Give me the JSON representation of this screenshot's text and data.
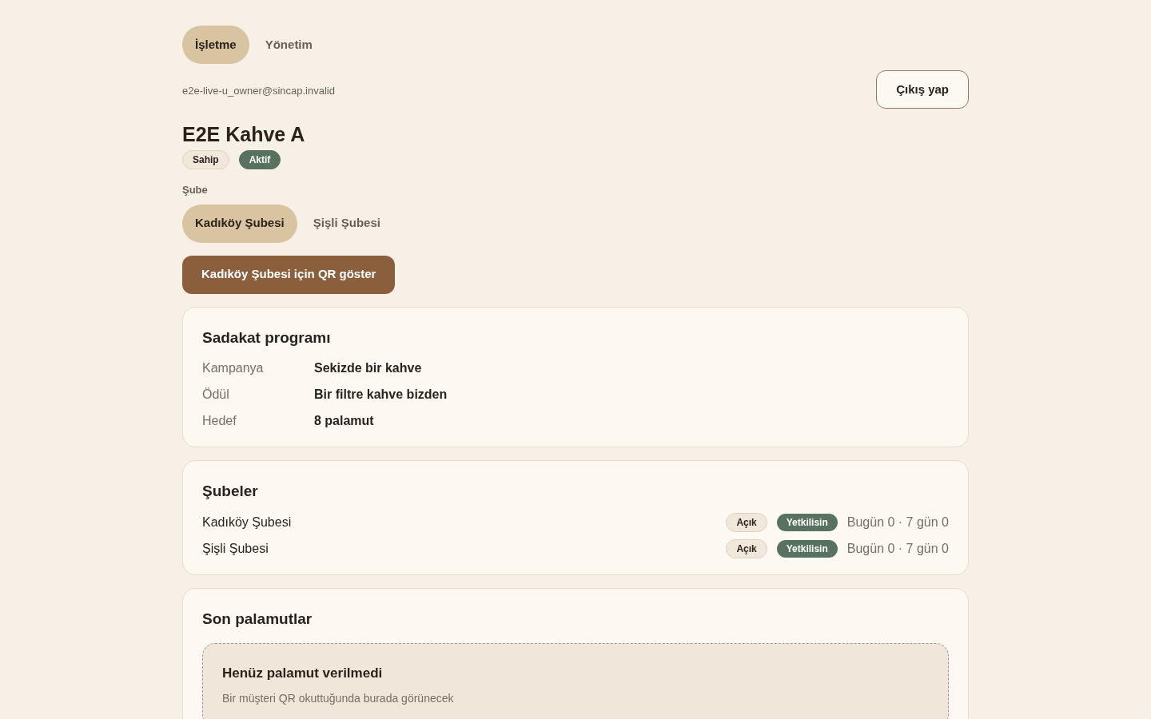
{
  "top_tabs": [
    {
      "label": "İşletme",
      "selected": true
    },
    {
      "label": "Yönetim",
      "selected": false
    }
  ],
  "account": {
    "email": "e2e-live-u_owner@sincap.invalid",
    "logout": "Çıkış yap"
  },
  "business": {
    "name": "E2E Kahve A",
    "badges": [
      {
        "label": "Sahip",
        "kind": "neutral"
      },
      {
        "label": "Aktif",
        "kind": "success"
      }
    ]
  },
  "branch_picker": {
    "label": "Şube",
    "tabs": [
      {
        "label": "Kadıköy Şubesi",
        "selected": true
      },
      {
        "label": "Şişli Şubesi",
        "selected": false
      }
    ],
    "qr_button": "Kadıköy Şubesi için QR göster"
  },
  "loyalty": {
    "title": "Sadakat programı",
    "rows": [
      {
        "label": "Kampanya",
        "value": "Sekizde bir kahve"
      },
      {
        "label": "Ödül",
        "value": "Bir filtre kahve bizden"
      },
      {
        "label": "Hedef",
        "value": "8 palamut"
      }
    ]
  },
  "branches": {
    "title": "Şubeler",
    "rows": [
      {
        "name": "Kadıköy Şubesi",
        "status": "Açık",
        "role": "Yetkilisin",
        "stats": "Bugün 0 · 7 gün 0"
      },
      {
        "name": "Şişli Şubesi",
        "status": "Açık",
        "role": "Yetkilisin",
        "stats": "Bugün 0 · 7 gün 0"
      }
    ]
  },
  "recent": {
    "title": "Son palamutlar",
    "empty_title": "Henüz palamut verilmedi",
    "empty_text": "Bir müşteri QR okuttuğunda burada görünecek"
  }
}
